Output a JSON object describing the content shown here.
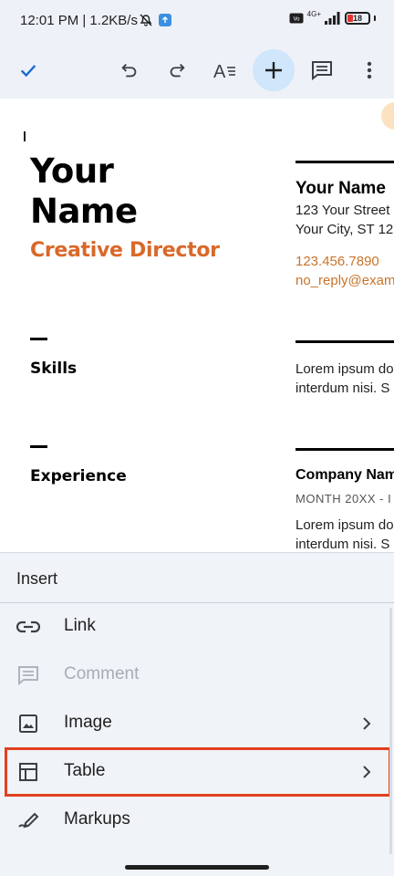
{
  "status_bar": {
    "time_speed": "12:01 PM | 1.2KB/s",
    "network": "4G+",
    "volte": "VoLTE",
    "battery": "18"
  },
  "toolbar": {
    "icons": [
      "check-icon",
      "undo-icon",
      "redo-icon",
      "text-format-icon",
      "add-icon",
      "comment-icon",
      "more-icon"
    ]
  },
  "document": {
    "name_line1": "Your",
    "name_line2": "Name",
    "job_title": "Creative Director",
    "contact_name": "Your Name",
    "street": "123 Your Street",
    "city": "Your City, ST 12",
    "phone": "123.456.7890",
    "email": "no_reply@exam",
    "skills_heading": "Skills",
    "skills_line1": "Lorem ipsum do",
    "skills_line2": "interdum nisi. S",
    "experience_heading": "Experience",
    "company": "Company Nam",
    "month": "MONTH 20XX - I",
    "exp_line1": "Lorem ipsum do",
    "exp_line2": "interdum nisi. S",
    "colors": {
      "accent": "#d9692a",
      "contact": "#c8742b"
    }
  },
  "insert_sheet": {
    "title": "Insert",
    "items": [
      {
        "label": "Link",
        "icon": "link-icon",
        "enabled": true,
        "has_submenu": false
      },
      {
        "label": "Comment",
        "icon": "comment-add-icon",
        "enabled": false,
        "has_submenu": false
      },
      {
        "label": "Image",
        "icon": "image-icon",
        "enabled": true,
        "has_submenu": true
      },
      {
        "label": "Table",
        "icon": "table-icon",
        "enabled": true,
        "has_submenu": true,
        "highlighted": true
      },
      {
        "label": "Markups",
        "icon": "markup-pen-icon",
        "enabled": true,
        "has_submenu": false
      }
    ],
    "highlight_color": "#e0401f"
  }
}
